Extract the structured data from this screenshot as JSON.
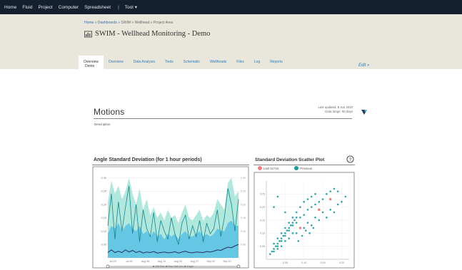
{
  "topnav": {
    "items": [
      "Home",
      "Fluid",
      "Project",
      "Computer",
      "Spreadsheet",
      "Tool"
    ]
  },
  "breadcrumb": {
    "link": "Home » Dashboards »",
    "rest": "SWIM » Wellhead » Project Area"
  },
  "page_title": "SWIM - Wellhead Monitoring - Demo",
  "tabs": [
    {
      "label": "Overview",
      "active": true
    },
    {
      "label": "Overview",
      "active": false
    },
    {
      "label": "Data Analysis",
      "active": false
    },
    {
      "label": "Tools",
      "active": false
    },
    {
      "label": "Schematic",
      "active": false
    },
    {
      "label": "Wellheads",
      "active": false
    },
    {
      "label": "Files",
      "active": false
    },
    {
      "label": "Log",
      "active": false
    },
    {
      "label": "Reports",
      "active": false
    }
  ],
  "description_label": "Demo",
  "edit_link": "Edit »",
  "section": {
    "title": "Motions",
    "subtitle": "Description",
    "meta_line1": "Last updated: 8 Jun 2019",
    "meta_line2": "Data range: 90 days"
  },
  "left_chart": {
    "title": "Angle Standard Deviation (for 1 hour periods)",
    "legend_text": "■ Std Dev ■ Max Std Dev ■ Angle"
  },
  "right_chart": {
    "title": "Standard Deviation Scatter Plot",
    "legend": [
      {
        "label": "Last 24 hrs",
        "color": "#f07f7f"
      },
      {
        "label": "Previous",
        "color": "#1a9aa0"
      }
    ]
  },
  "colors": {
    "topbar": "#15202e",
    "header": "#e9e6dc",
    "link": "#2f7cb8",
    "band": "#a8e6da",
    "area": "#59c1e6",
    "line": "#14848c",
    "dark_line": "#2a2f66",
    "scatter_recent": "#f07f7f",
    "scatter_previous": "#1a9aa0"
  },
  "chart_data": [
    {
      "type": "area",
      "title": "Angle Standard Deviation (for 1 hour periods)",
      "x_tick_labels": [
        "Jul 23",
        "Jul 30",
        "Aug 06",
        "Aug 13",
        "Aug 20",
        "Aug 27",
        "Sep 03",
        "Sep 10"
      ],
      "y_tick_labels": [
        "0.05",
        "0.10",
        "0.15",
        "0.20",
        "0.25",
        "0.30"
      ],
      "ylim": [
        0,
        0.32
      ],
      "series": [
        {
          "name": "Max",
          "values": [
            0.21,
            0.29,
            0.24,
            0.27,
            0.22,
            0.25,
            0.3,
            0.24,
            0.2,
            0.26,
            0.18,
            0.22,
            0.16,
            0.19,
            0.15,
            0.17,
            0.14,
            0.18,
            0.15,
            0.16,
            0.13,
            0.17,
            0.2,
            0.15,
            0.14,
            0.16,
            0.18,
            0.14,
            0.16,
            0.15,
            0.17,
            0.22,
            0.2,
            0.18,
            0.28,
            0.3,
            0.23,
            0.25
          ]
        },
        {
          "name": "Mid",
          "values": [
            0.09,
            0.12,
            0.11,
            0.13,
            0.1,
            0.12,
            0.13,
            0.11,
            0.1,
            0.12,
            0.09,
            0.1,
            0.08,
            0.1,
            0.08,
            0.09,
            0.07,
            0.09,
            0.08,
            0.09,
            0.07,
            0.09,
            0.1,
            0.08,
            0.08,
            0.09,
            0.1,
            0.08,
            0.09,
            0.08,
            0.09,
            0.11,
            0.1,
            0.1,
            0.13,
            0.14,
            0.12,
            0.12
          ]
        },
        {
          "name": "Std Dev",
          "values": [
            0.12,
            0.24,
            0.07,
            0.21,
            0.1,
            0.19,
            0.27,
            0.09,
            0.2,
            0.06,
            0.18,
            0.11,
            0.08,
            0.17,
            0.06,
            0.14,
            0.1,
            0.07,
            0.15,
            0.09,
            0.05,
            0.13,
            0.16,
            0.07,
            0.12,
            0.08,
            0.14,
            0.06,
            0.13,
            0.09,
            0.11,
            0.18,
            0.08,
            0.15,
            0.26,
            0.2,
            0.1,
            0.22
          ]
        },
        {
          "name": "Angle",
          "values": [
            0.02,
            0.03,
            0.02,
            0.025,
            0.02,
            0.03,
            0.022,
            0.028,
            0.02,
            0.025,
            0.018,
            0.022,
            0.02,
            0.024,
            0.018,
            0.02,
            0.022,
            0.019,
            0.02,
            0.023,
            0.018,
            0.022,
            0.025,
            0.02,
            0.019,
            0.022,
            0.021,
            0.02,
            0.024,
            0.022,
            0.025,
            0.03,
            0.028,
            0.035,
            0.04,
            0.038,
            0.045,
            0.05
          ]
        }
      ]
    },
    {
      "type": "scatter",
      "title": "Standard Deviation Scatter Plot",
      "x_tick_labels": [
        "0.05",
        "0.10",
        "0.15",
        "0.20"
      ],
      "y_tick_labels": [
        "0.05",
        "0.10",
        "0.15",
        "0.20",
        "0.25"
      ],
      "xlim": [
        0,
        0.22
      ],
      "ylim": [
        0,
        0.3
      ],
      "series": [
        {
          "name": "Previous",
          "points": [
            [
              0.01,
              0.02
            ],
            [
              0.015,
              0.03
            ],
            [
              0.02,
              0.04
            ],
            [
              0.025,
              0.05
            ],
            [
              0.03,
              0.06
            ],
            [
              0.035,
              0.07
            ],
            [
              0.04,
              0.08
            ],
            [
              0.045,
              0.09
            ],
            [
              0.05,
              0.1
            ],
            [
              0.055,
              0.11
            ],
            [
              0.06,
              0.12
            ],
            [
              0.065,
              0.13
            ],
            [
              0.07,
              0.14
            ],
            [
              0.075,
              0.15
            ],
            [
              0.08,
              0.16
            ],
            [
              0.02,
              0.03
            ],
            [
              0.03,
              0.05
            ],
            [
              0.04,
              0.07
            ],
            [
              0.05,
              0.09
            ],
            [
              0.06,
              0.11
            ],
            [
              0.07,
              0.13
            ],
            [
              0.08,
              0.14
            ],
            [
              0.09,
              0.16
            ],
            [
              0.1,
              0.17
            ],
            [
              0.11,
              0.19
            ],
            [
              0.12,
              0.2
            ],
            [
              0.13,
              0.21
            ],
            [
              0.14,
              0.22
            ],
            [
              0.15,
              0.23
            ],
            [
              0.16,
              0.25
            ],
            [
              0.17,
              0.26
            ],
            [
              0.18,
              0.27
            ],
            [
              0.03,
              0.04
            ],
            [
              0.05,
              0.07
            ],
            [
              0.07,
              0.1
            ],
            [
              0.09,
              0.12
            ],
            [
              0.11,
              0.14
            ],
            [
              0.13,
              0.16
            ],
            [
              0.15,
              0.18
            ],
            [
              0.17,
              0.19
            ],
            [
              0.19,
              0.21
            ],
            [
              0.04,
              0.05
            ],
            [
              0.06,
              0.08
            ],
            [
              0.08,
              0.1
            ],
            [
              0.1,
              0.12
            ],
            [
              0.12,
              0.13
            ],
            [
              0.14,
              0.15
            ],
            [
              0.16,
              0.16
            ],
            [
              0.18,
              0.18
            ],
            [
              0.02,
              0.06
            ],
            [
              0.03,
              0.08
            ],
            [
              0.04,
              0.1
            ],
            [
              0.05,
              0.12
            ],
            [
              0.06,
              0.14
            ],
            [
              0.07,
              0.16
            ],
            [
              0.08,
              0.18
            ],
            [
              0.09,
              0.2
            ],
            [
              0.1,
              0.22
            ],
            [
              0.11,
              0.23
            ],
            [
              0.12,
              0.24
            ],
            [
              0.13,
              0.25
            ],
            [
              0.2,
              0.22
            ],
            [
              0.21,
              0.24
            ],
            [
              0.19,
              0.26
            ],
            [
              0.085,
              0.07
            ],
            [
              0.095,
              0.09
            ],
            [
              0.105,
              0.11
            ],
            [
              0.115,
              0.1
            ],
            [
              0.125,
              0.12
            ],
            [
              0.02,
              0.2
            ],
            [
              0.03,
              0.24
            ],
            [
              0.05,
              0.18
            ]
          ]
        },
        {
          "name": "Last 24 hrs",
          "points": [
            [
              0.09,
              0.12
            ],
            [
              0.14,
              0.19
            ],
            [
              0.17,
              0.23
            ]
          ]
        }
      ]
    }
  ]
}
